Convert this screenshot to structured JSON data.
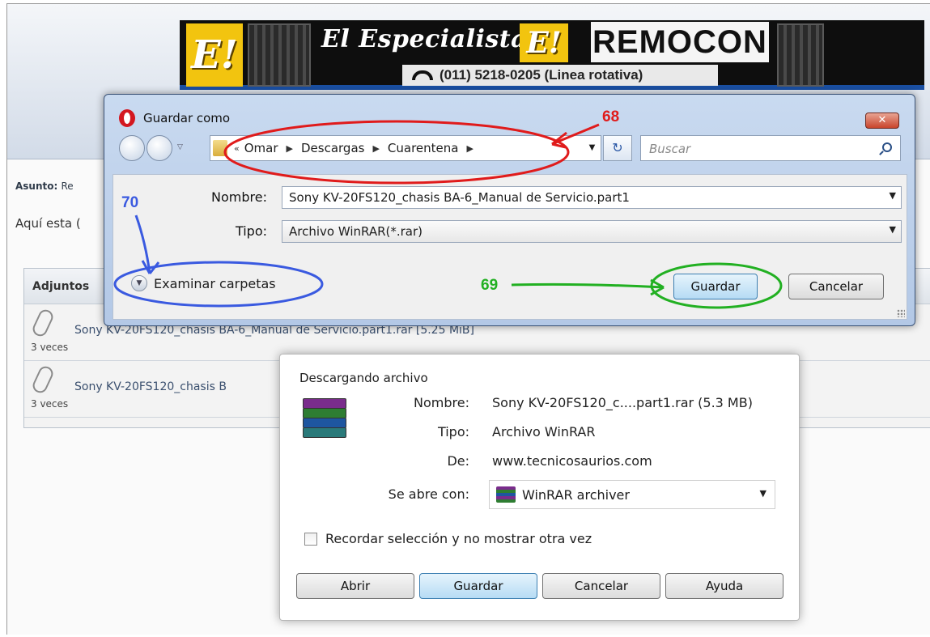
{
  "background_page": {
    "banner": {
      "title": "El Especialista!",
      "logo_letter": "E!",
      "phone": "(011) 5218-0205 (Linea rotativa)",
      "brand": "REMOCON"
    },
    "subject_label": "Asunto:",
    "subject_value": "Re",
    "post_text": "Aquí esta (",
    "attachments_header": "Adjuntos",
    "attachments": [
      {
        "name": "Sony KV-20FS120_chasis BA-6_Manual de Servicio.part1.rar [5.25 MiB]",
        "count": "3 veces"
      },
      {
        "name": "Sony KV-20FS120_chasis B",
        "count": "3 veces"
      }
    ]
  },
  "save_dialog": {
    "title": "Guardar como",
    "close_label": "✕",
    "breadcrumb": [
      "Omar",
      "Descargas",
      "Cuarentena"
    ],
    "search_placeholder": "Buscar",
    "name_label": "Nombre:",
    "name_value": "Sony KV-20FS120_chasis BA-6_Manual de Servicio.part1",
    "type_label": "Tipo:",
    "type_value": "Archivo WinRAR(*.rar)",
    "browse_label": "Examinar carpetas",
    "save_button": "Guardar",
    "cancel_button": "Cancelar"
  },
  "download_dialog": {
    "title": "Descargando archivo",
    "name_label": "Nombre:",
    "name_value": "Sony KV-20FS120_c....part1.rar (5.3 MB)",
    "type_label": "Tipo:",
    "type_value": "Archivo WinRAR",
    "from_label": "De:",
    "from_value": "www.tecnicosaurios.com",
    "open_with_label": "Se abre con:",
    "open_with_value": "WinRAR archiver",
    "remember_label": "Recordar selección y no mostrar otra vez",
    "buttons": {
      "open": "Abrir",
      "save": "Guardar",
      "cancel": "Cancelar",
      "help": "Ayuda"
    }
  },
  "annotations": {
    "n68": "68",
    "n69": "69",
    "n70": "70",
    "colors": {
      "red": "#e01b1b",
      "green": "#22b022",
      "blue": "#3a5ae0"
    }
  }
}
